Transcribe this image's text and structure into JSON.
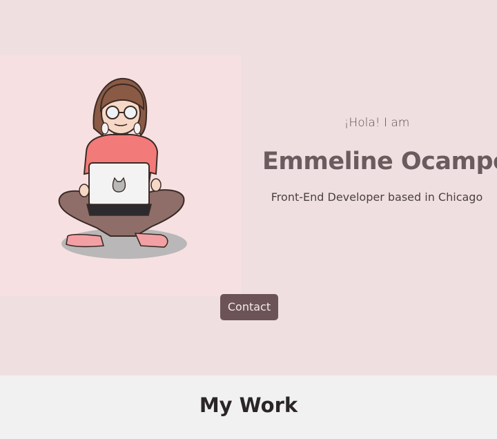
{
  "hero": {
    "greeting": "¡Hola! I am",
    "name": "Emmeline Ocampo",
    "role": "Front-End Developer based in Chicago",
    "contact_label": "Contact"
  },
  "work": {
    "title": "My Work"
  },
  "colors": {
    "hero_bg": "#efdfe0",
    "illustration_bg": "#f6e0e2",
    "button_bg": "#6b5357",
    "name_text": "#6b5a5e",
    "work_bg": "#f1f1f1"
  },
  "illustration": {
    "subject": "girl-with-glasses-sitting-cross-legged-with-laptop-icon"
  }
}
